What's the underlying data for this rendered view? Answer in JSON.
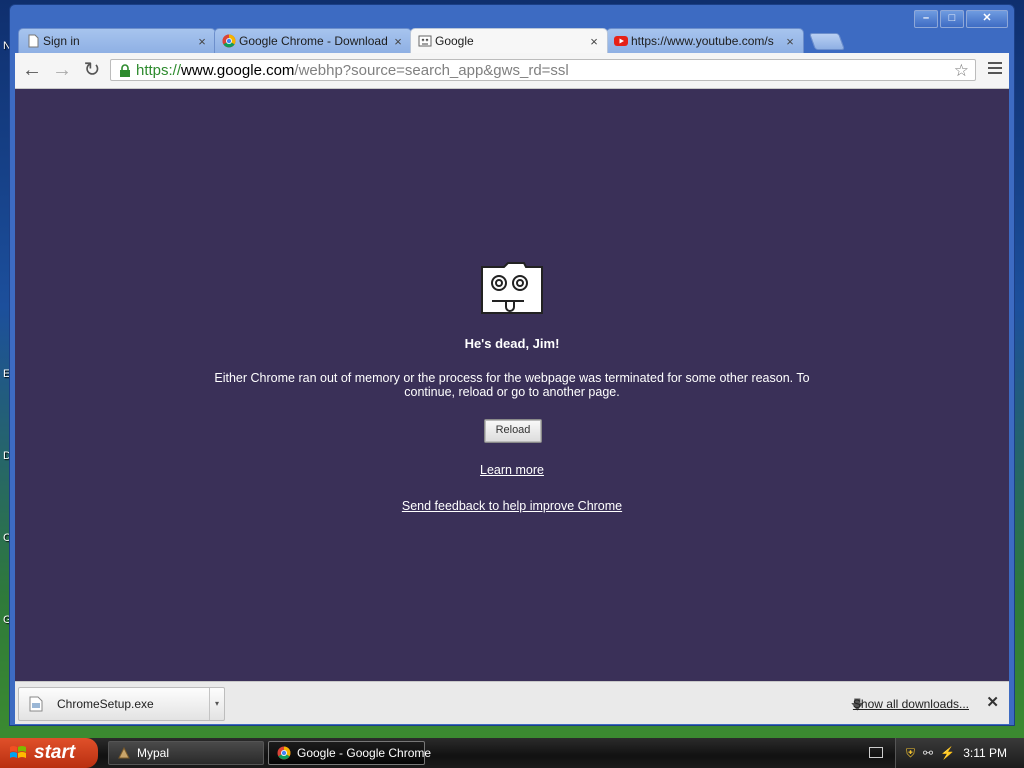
{
  "desktop": {
    "edge_letters": [
      "N",
      "E",
      "D",
      "C",
      "G"
    ]
  },
  "window": {
    "controls": {
      "minimize": "–",
      "maximize": "□",
      "close": "✕"
    }
  },
  "tabs": [
    {
      "title": "Sign in",
      "icon": "page-icon",
      "close": "×",
      "active": false
    },
    {
      "title": "Google Chrome - Download t",
      "icon": "chrome-icon",
      "close": "×",
      "active": false
    },
    {
      "title": "Google",
      "icon": "sad-page-icon",
      "close": "×",
      "active": true
    },
    {
      "title": "https://www.youtube.com/s",
      "icon": "youtube-icon",
      "close": "×",
      "active": false
    }
  ],
  "toolbar": {
    "back_icon": "←",
    "forward_icon": "→",
    "reload_icon": "↻",
    "url_scheme": "https://",
    "url_host": "www.google.com",
    "url_path": "/webhp?source=search_app&gws_rd=ssl",
    "star_icon": "☆"
  },
  "crash_page": {
    "title": "He's dead, Jim!",
    "message": "Either Chrome ran out of memory or the process for the webpage was terminated for some other reason.  To continue, reload or go to another page.",
    "reload_label": "Reload",
    "learn_more": "Learn more",
    "feedback": "Send feedback to help improve Chrome"
  },
  "downloads": {
    "file_name": "ChromeSetup.exe",
    "dropdown_icon": "▾",
    "show_all": "Show all downloads...",
    "close_icon": "✕"
  },
  "taskbar": {
    "start_label": "start",
    "items": [
      {
        "label": "Mypal",
        "icon": "mypal-icon",
        "active": false
      },
      {
        "label": "Google - Google Chrome",
        "icon": "chrome-icon",
        "active": true
      }
    ],
    "clock": "3:11 PM"
  },
  "colors": {
    "crash_background": "#3a3058",
    "url_scheme": "#2e8b2e",
    "start_button": "#d2451f"
  }
}
